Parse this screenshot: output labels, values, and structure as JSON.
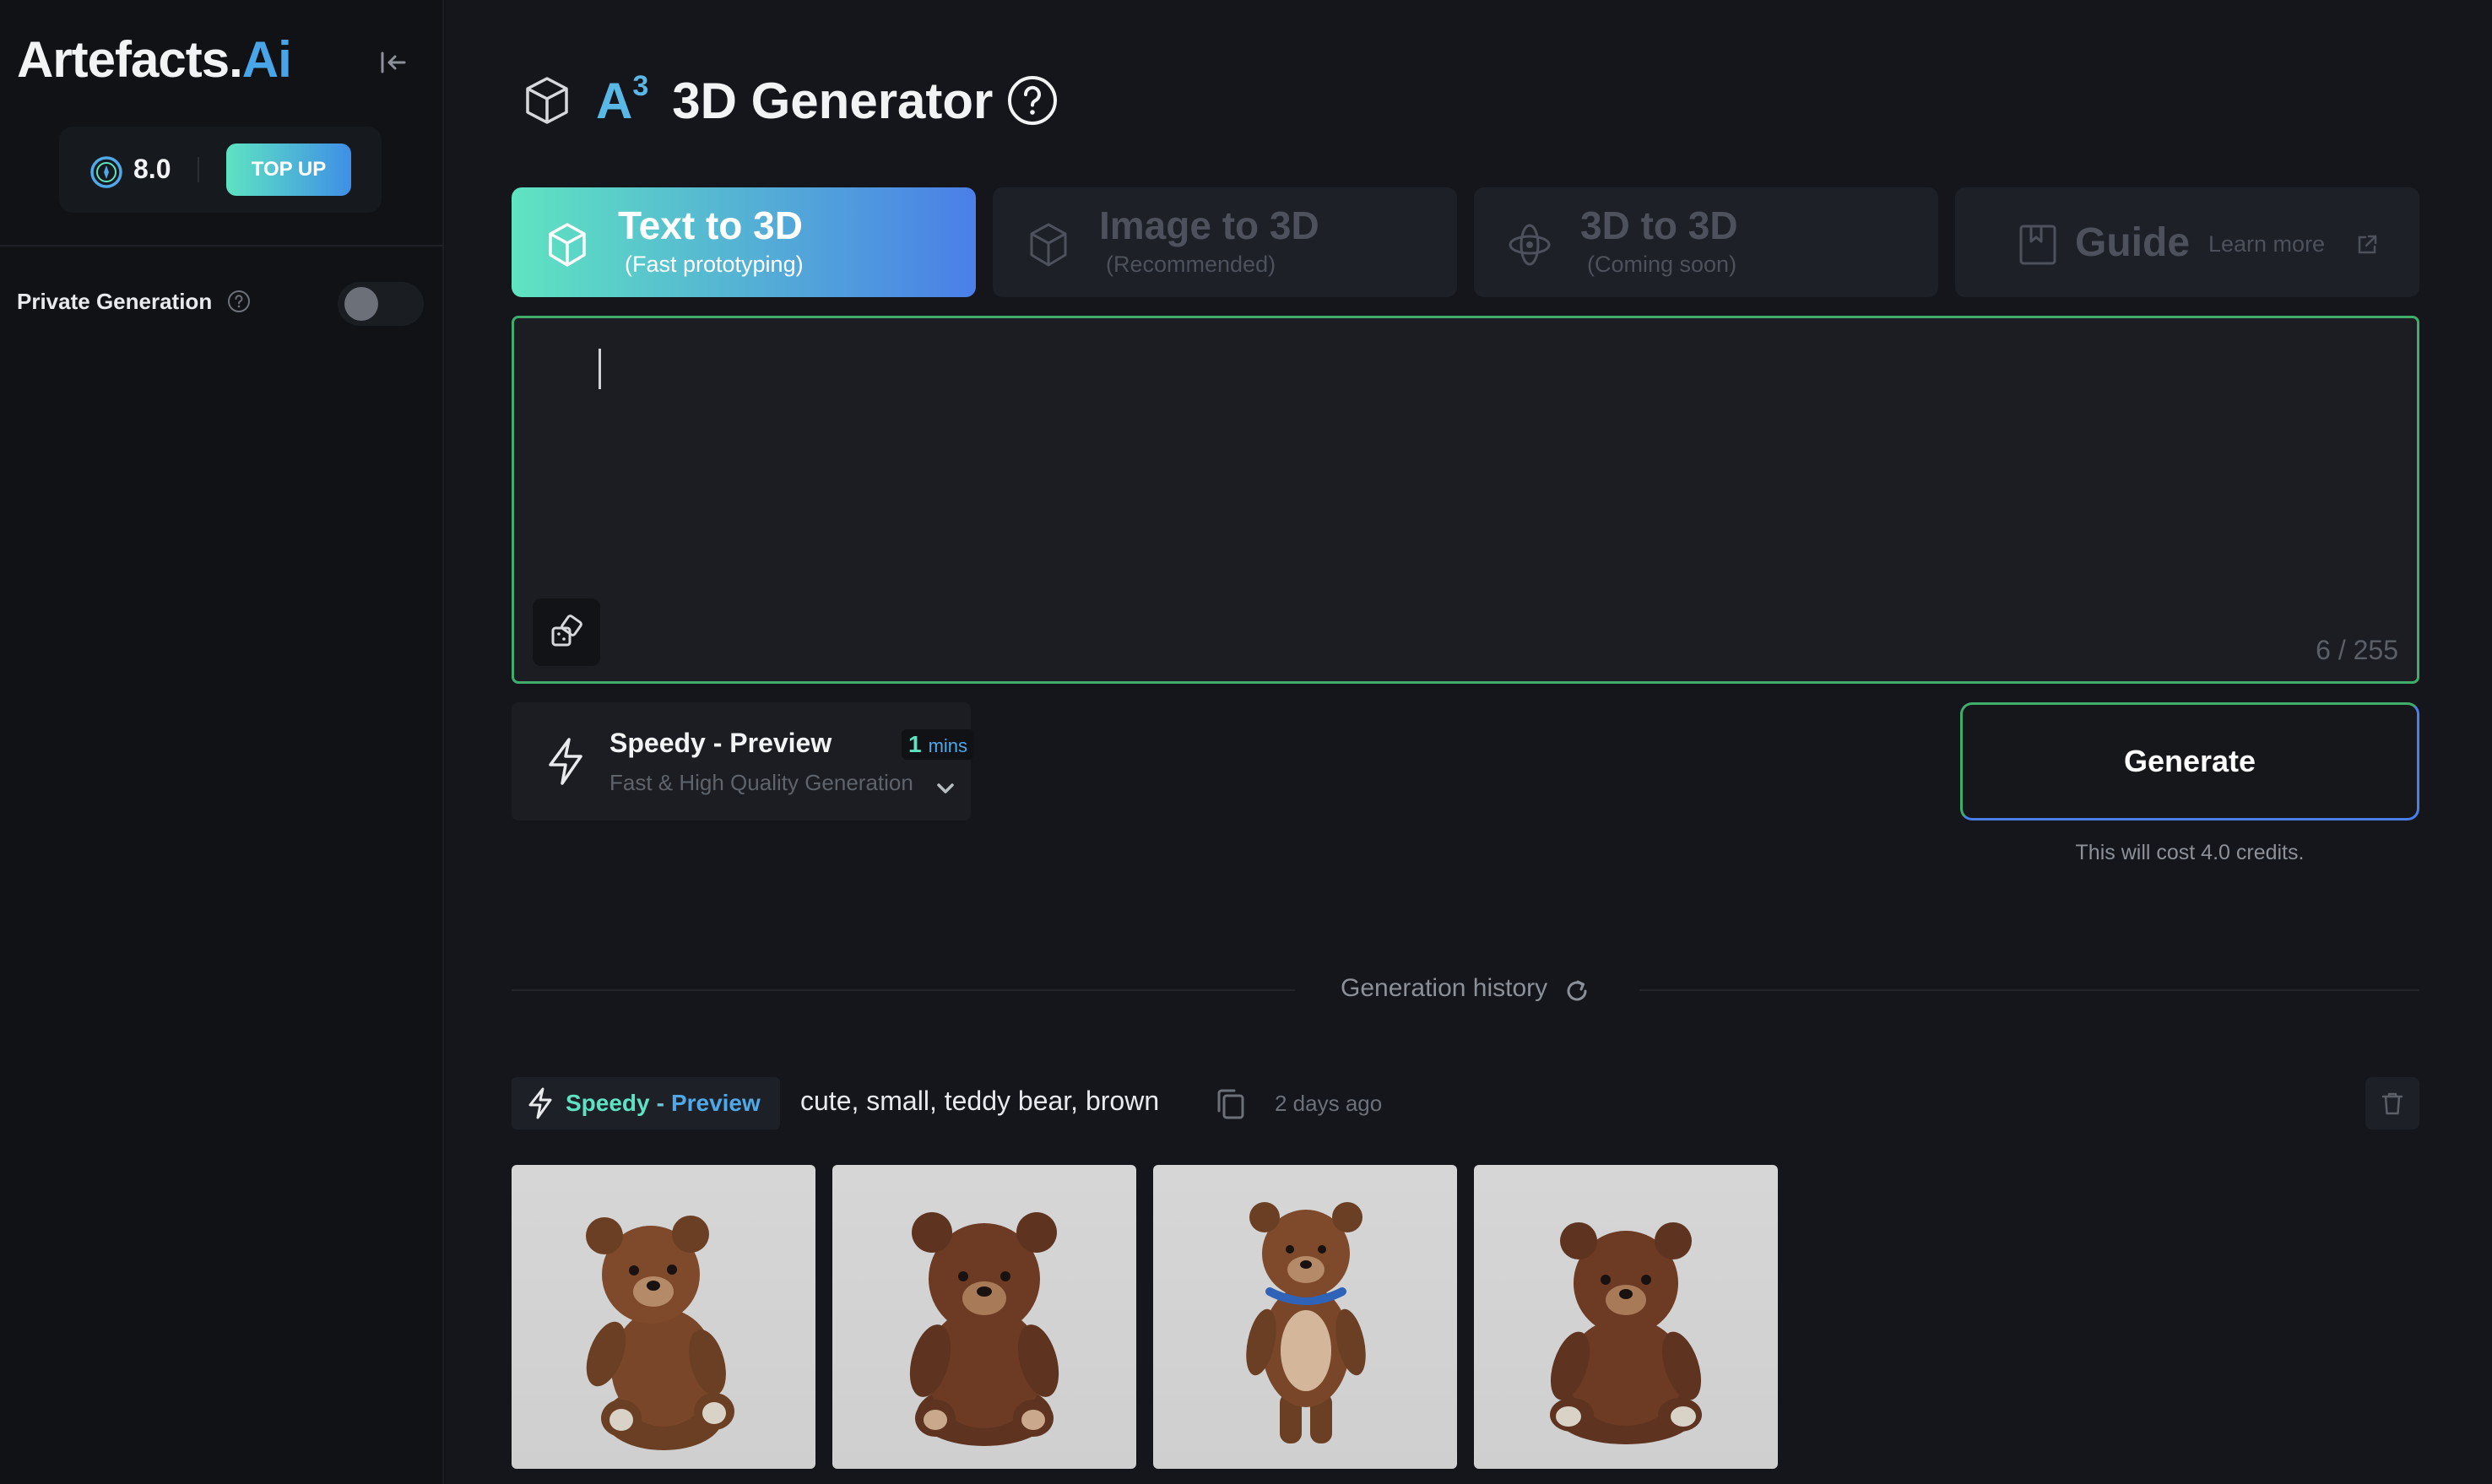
{
  "sidebar": {
    "logo_main": "Artefacts.",
    "logo_accent": "Ai",
    "credits": "8.0",
    "topup_label": "TOP UP",
    "private_generation_label": "Private Generation",
    "private_generation_enabled": false
  },
  "header": {
    "brand_mark": "A",
    "brand_sup": "3",
    "title": "3D Generator"
  },
  "tabs": [
    {
      "title": "Text to 3D",
      "subtitle": "(Fast prototyping)",
      "active": true,
      "icon": "cube-icon"
    },
    {
      "title": "Image to 3D",
      "subtitle": "(Recommended)",
      "active": false,
      "icon": "cube-icon"
    },
    {
      "title": "3D to 3D",
      "subtitle": "(Coming soon)",
      "active": false,
      "icon": "orbit-icon"
    },
    {
      "title": "Guide",
      "link": "Learn more",
      "active": false,
      "icon": "book-icon"
    }
  ],
  "prompt": {
    "value": "",
    "char_count": "6 / 255"
  },
  "model": {
    "name": "Speedy - Preview",
    "time_value": "1",
    "time_unit": "mins",
    "description": "Fast & High Quality Generation"
  },
  "generate": {
    "label": "Generate",
    "cost_note": "This will cost 4.0 credits."
  },
  "history": {
    "title": "Generation history",
    "items": [
      {
        "badge_part1": "Speedy",
        "badge_sep": "-",
        "badge_part2": "Preview",
        "prompt": "cute, small, teddy bear, brown",
        "time": "2 days ago",
        "thumbnails": 4
      }
    ]
  },
  "colors": {
    "accent_green": "#5ee3c2",
    "accent_blue": "#4a7fe8",
    "prompt_border": "#3fae6c",
    "background": "#14161b"
  }
}
